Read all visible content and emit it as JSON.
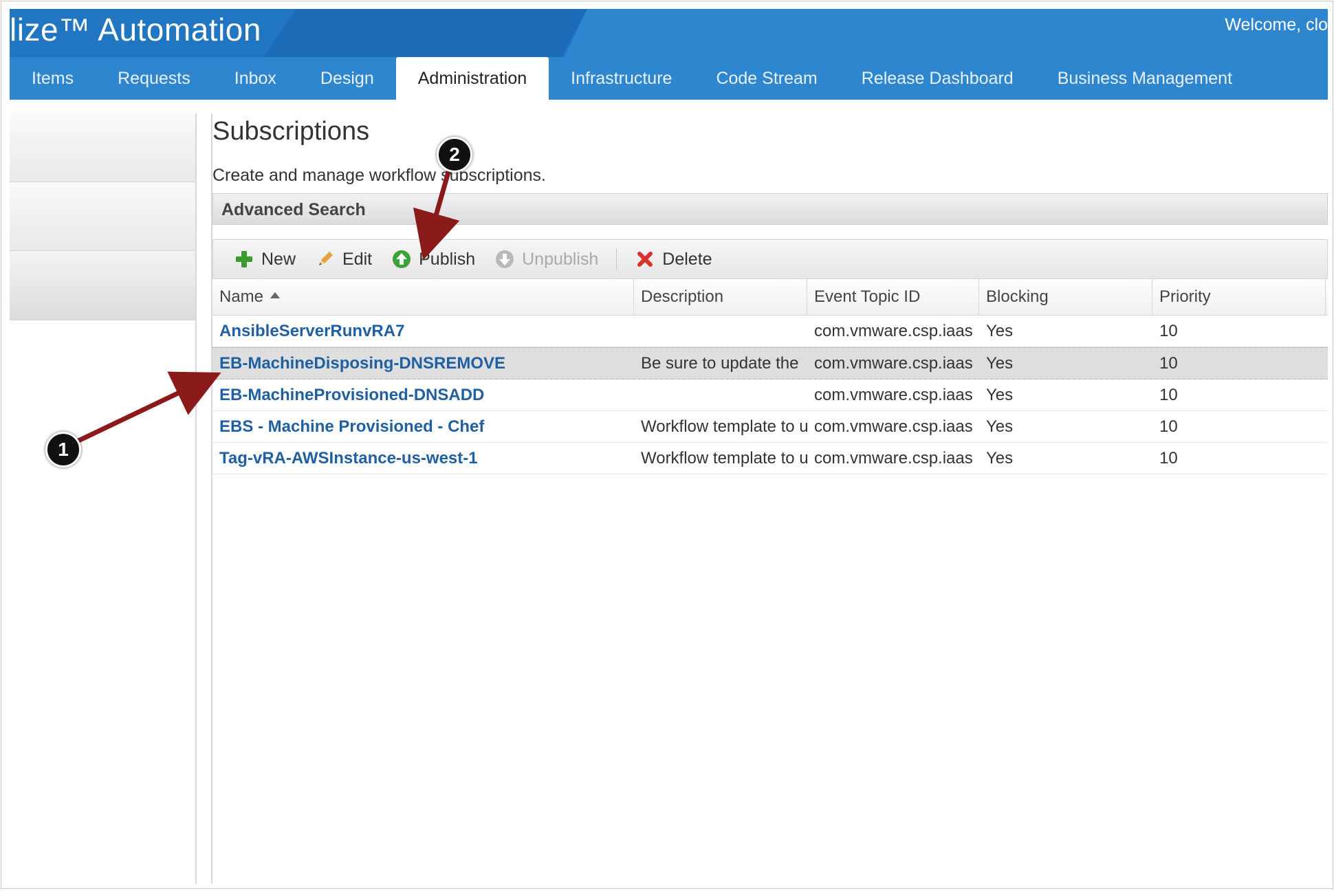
{
  "header": {
    "brand": "lize™ Automation",
    "welcome": "Welcome, clo",
    "nav": [
      "Items",
      "Requests",
      "Inbox",
      "Design",
      "Administration",
      "Infrastructure",
      "Code Stream",
      "Release Dashboard",
      "Business Management"
    ],
    "active_tab": "Administration",
    "colors": {
      "header_bg": "#2e86cf",
      "header_dark": "#1c6cb8"
    }
  },
  "page": {
    "title": "Subscriptions",
    "description": "Create and manage workflow subscriptions.",
    "advanced_search": "Advanced Search"
  },
  "toolbar": {
    "new": "New",
    "edit": "Edit",
    "publish": "Publish",
    "unpublish": "Unpublish",
    "delete": "Delete"
  },
  "table": {
    "columns": [
      "Name",
      "Description",
      "Event Topic ID",
      "Blocking",
      "Priority"
    ],
    "rows": [
      {
        "name": "AnsibleServerRunvRA7",
        "description": "",
        "topic": "com.vmware.csp.iaas",
        "blocking": "Yes",
        "priority": "10"
      },
      {
        "name": "EB-MachineDisposing-DNSREMOVE",
        "description": "Be sure to update the",
        "topic": "com.vmware.csp.iaas",
        "blocking": "Yes",
        "priority": "10"
      },
      {
        "name": "EB-MachineProvisioned-DNSADD",
        "description": "",
        "topic": "com.vmware.csp.iaas",
        "blocking": "Yes",
        "priority": "10"
      },
      {
        "name": "EBS - Machine Provisioned - Chef",
        "description": "Workflow template to u",
        "topic": "com.vmware.csp.iaas",
        "blocking": "Yes",
        "priority": "10"
      },
      {
        "name": "Tag-vRA-AWSInstance-us-west-1",
        "description": "Workflow template to u",
        "topic": "com.vmware.csp.iaas",
        "blocking": "Yes",
        "priority": "10"
      }
    ]
  },
  "callouts": {
    "one": "1",
    "two": "2"
  }
}
